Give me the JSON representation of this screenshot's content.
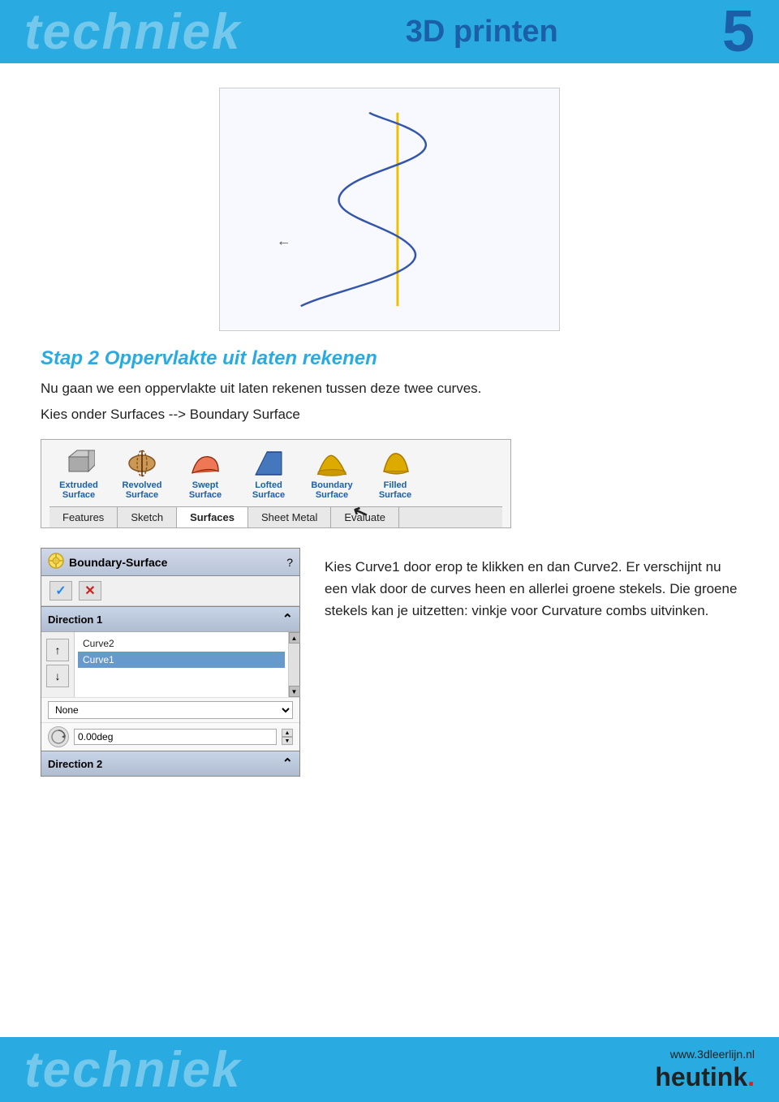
{
  "header": {
    "watermark": "techniek",
    "title": "3D printen",
    "number": "5"
  },
  "top_image": {
    "alt": "Two curves in 3D space - blue spiral curve and yellow vertical line"
  },
  "step": {
    "title": "Stap 2 Oppervlakte uit laten rekenen",
    "text1": "Nu gaan we een oppervlakte uit laten rekenen tussen deze twee curves.",
    "text2": "Kies onder Surfaces --> Boundary Surface"
  },
  "toolbar": {
    "icons": [
      {
        "label": "Extruded\nSurface",
        "id": "extruded"
      },
      {
        "label": "Revolved\nSurface",
        "id": "revolved"
      },
      {
        "label": "Swept\nSurface",
        "id": "swept"
      },
      {
        "label": "Lofted\nSurface",
        "id": "lofted"
      },
      {
        "label": "Boundary\nSurface",
        "id": "boundary"
      },
      {
        "label": "Filled\nSurface",
        "id": "filled"
      }
    ],
    "tabs": [
      {
        "label": "Features",
        "active": false
      },
      {
        "label": "Sketch",
        "active": false
      },
      {
        "label": "Surfaces",
        "active": true
      },
      {
        "label": "Sheet Metal",
        "active": false
      },
      {
        "label": "Evaluate",
        "active": false
      }
    ]
  },
  "panel": {
    "title": "Boundary-Surface",
    "question_mark": "?",
    "check_label": "✓",
    "x_label": "✕",
    "direction1_label": "Direction 1",
    "direction1_expand": "⌃",
    "direction2_label": "Direction 2",
    "direction2_expand": "⌃",
    "curves": [
      {
        "name": "Curve2",
        "selected": false
      },
      {
        "name": "Curve1",
        "selected": true
      }
    ],
    "none_label": "None",
    "deg_label": "0.00deg",
    "up_arrow": "▲",
    "down_arrow": "▼"
  },
  "right_text": {
    "paragraph": "Kies Curve1 door erop te klikken en dan Curve2. Er verschijnt nu een vlak door de curves heen en allerlei groene stekels. Die groene stekels kan je uitzetten: vinkje voor Curvature combs uitvinken."
  },
  "footer": {
    "watermark": "techniek",
    "url": "www.3dleerlijn.nl",
    "brand": "heutink",
    "dot": "."
  }
}
